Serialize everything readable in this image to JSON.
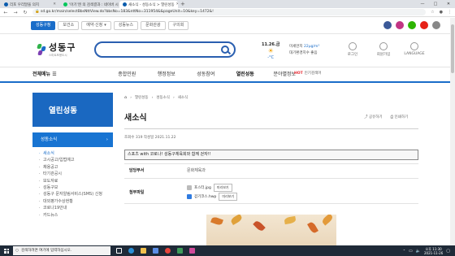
{
  "browser": {
    "tabs": [
      {
        "label": "리포 우리말을 의지",
        "active": false
      },
      {
        "label": "'아기'엔 의 검색결과 : 네이버 시",
        "active": false
      },
      {
        "label": "새소식 - 성동소식 > 열린성동",
        "active": true
      }
    ],
    "new_tab": "+",
    "url": "sd.go.kr/main/selectBbsNttView.do?bbsNo=183&nttNo=311954&&pageUnit=10&key=1472&!",
    "win_controls": [
      "—",
      "□",
      "✕"
    ]
  },
  "top_strip": {
    "links": [
      "성동구청",
      "보건소",
      "예약·신청",
      "성동뉴스",
      "문화관광",
      "구의회"
    ]
  },
  "header": {
    "logo_title": "성동구",
    "logo_sub": "스마트포용도시",
    "weather_date": "11.26.금",
    "weather_temp": "-°C",
    "air_line1": "미세먼지",
    "air_value": "22μg/m³",
    "air_line2": "대기환경지수 좋음",
    "utils": [
      "로그인",
      "회원가입",
      "LANGUAGE"
    ]
  },
  "nav": {
    "all_menu": "전체메뉴",
    "items": [
      "종합민원",
      "행정정보",
      "성동참여",
      "열린성동",
      "분야별정보"
    ],
    "active_index": 3,
    "hot_label": "HOT",
    "hot_text": "인기검색어"
  },
  "sidebar": {
    "banner": "열린성동",
    "section": "성동소식",
    "section_chev": "›",
    "items": [
      "새소식",
      "고시공고/입법예고",
      "채용공고",
      "타기관공시",
      "보도자료",
      "성동구보",
      "성동구 문자알림서비스(SMS) 신청",
      "대외평가수상현황",
      "코로나19안내",
      "카드뉴스"
    ]
  },
  "main": {
    "breadcrumb": [
      "⌂",
      "열린성동",
      "성동소식",
      "새소식"
    ],
    "title": "새소식",
    "share": "공유하기",
    "print": "인쇄하기",
    "meta": "조회수 319 작성일 2021.11.22",
    "post_title": "스포츠 with 코로나! 성동구체육회와 함께 걷자!!",
    "dept_label": "담당부서",
    "dept_value": "문화체육과",
    "files_label": "첨부파일",
    "files": [
      {
        "name": "포스터.jpg",
        "btn": "미리보기"
      },
      {
        "name": "걷기코스.hwp",
        "btn": "미리보기"
      }
    ]
  },
  "taskbar": {
    "search_placeholder": "검색하려면 여기에 입력하십시오.",
    "time": "오후 11:30",
    "date": "2021-11-26"
  },
  "colors": {
    "brand_blue": "#1a6dc9",
    "sidebar_blue": "#1a68c1",
    "hot_red": "#e8262e"
  }
}
